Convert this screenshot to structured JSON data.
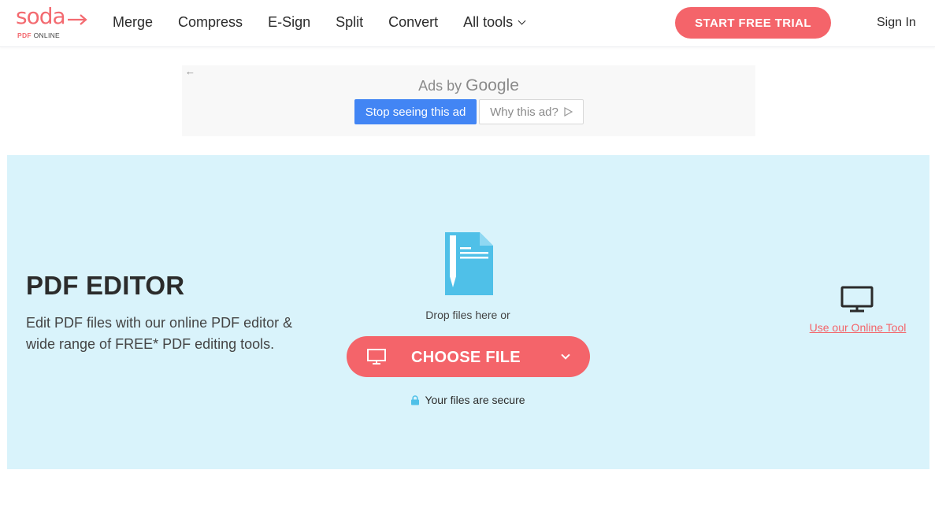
{
  "header": {
    "logo": {
      "word": "soda",
      "sub_brand": "PDF",
      "sub_rest": "ONLINE"
    },
    "nav": [
      {
        "label": "Merge"
      },
      {
        "label": "Compress"
      },
      {
        "label": "E-Sign"
      },
      {
        "label": "Split"
      },
      {
        "label": "Convert"
      },
      {
        "label": "All tools",
        "has_dropdown": true
      }
    ],
    "cta_label": "START FREE TRIAL",
    "signin_label": "Sign In"
  },
  "ad": {
    "back_glyph": "←",
    "label_prefix": "Ads by",
    "label_brand": "Google",
    "stop_label": "Stop seeing this ad",
    "why_label": "Why this ad?"
  },
  "hero": {
    "title": "PDF EDITOR",
    "description": "Edit PDF files with our online PDF editor & wide range of FREE* PDF editing tools.",
    "drop_text": "Drop files here or",
    "choose_label": "CHOOSE FILE",
    "secure_text": "Your files are secure",
    "online_link": "Use our Online Tool"
  },
  "colors": {
    "accent": "#f4646a",
    "hero_bg": "#d9f3fb",
    "doc_icon": "#4fc0e8",
    "google_blue": "#4285f4"
  },
  "icons": [
    "logo-arrow-icon",
    "chevron-down-icon",
    "back-arrow-icon",
    "play-icon",
    "document-pencil-icon",
    "monitor-icon",
    "lock-icon"
  ]
}
